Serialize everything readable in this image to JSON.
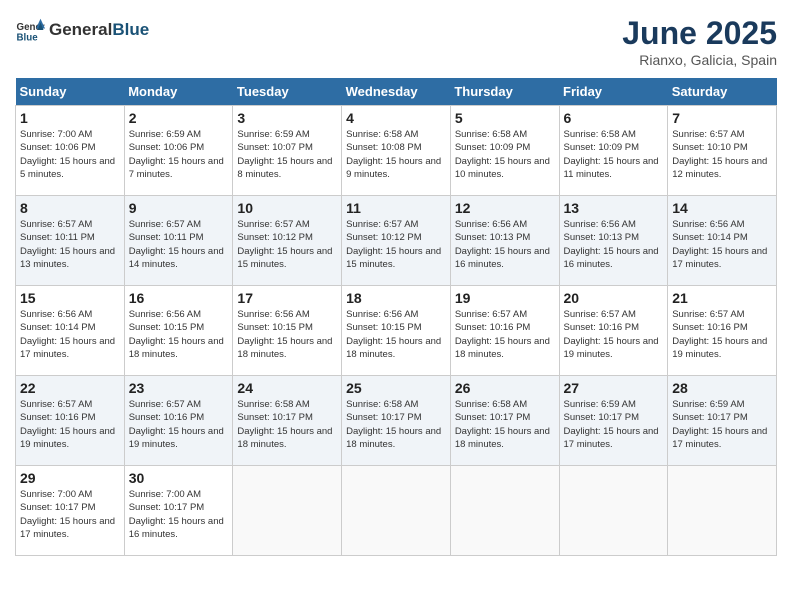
{
  "header": {
    "logo_general": "General",
    "logo_blue": "Blue",
    "month_title": "June 2025",
    "location": "Rianxo, Galicia, Spain"
  },
  "weekdays": [
    "Sunday",
    "Monday",
    "Tuesday",
    "Wednesday",
    "Thursday",
    "Friday",
    "Saturday"
  ],
  "weeks": [
    [
      {
        "day": "1",
        "sunrise": "7:00 AM",
        "sunset": "10:06 PM",
        "daylight": "15 hours and 5 minutes."
      },
      {
        "day": "2",
        "sunrise": "6:59 AM",
        "sunset": "10:06 PM",
        "daylight": "15 hours and 7 minutes."
      },
      {
        "day": "3",
        "sunrise": "6:59 AM",
        "sunset": "10:07 PM",
        "daylight": "15 hours and 8 minutes."
      },
      {
        "day": "4",
        "sunrise": "6:58 AM",
        "sunset": "10:08 PM",
        "daylight": "15 hours and 9 minutes."
      },
      {
        "day": "5",
        "sunrise": "6:58 AM",
        "sunset": "10:09 PM",
        "daylight": "15 hours and 10 minutes."
      },
      {
        "day": "6",
        "sunrise": "6:58 AM",
        "sunset": "10:09 PM",
        "daylight": "15 hours and 11 minutes."
      },
      {
        "day": "7",
        "sunrise": "6:57 AM",
        "sunset": "10:10 PM",
        "daylight": "15 hours and 12 minutes."
      }
    ],
    [
      {
        "day": "8",
        "sunrise": "6:57 AM",
        "sunset": "10:11 PM",
        "daylight": "15 hours and 13 minutes."
      },
      {
        "day": "9",
        "sunrise": "6:57 AM",
        "sunset": "10:11 PM",
        "daylight": "15 hours and 14 minutes."
      },
      {
        "day": "10",
        "sunrise": "6:57 AM",
        "sunset": "10:12 PM",
        "daylight": "15 hours and 15 minutes."
      },
      {
        "day": "11",
        "sunrise": "6:57 AM",
        "sunset": "10:12 PM",
        "daylight": "15 hours and 15 minutes."
      },
      {
        "day": "12",
        "sunrise": "6:56 AM",
        "sunset": "10:13 PM",
        "daylight": "15 hours and 16 minutes."
      },
      {
        "day": "13",
        "sunrise": "6:56 AM",
        "sunset": "10:13 PM",
        "daylight": "15 hours and 16 minutes."
      },
      {
        "day": "14",
        "sunrise": "6:56 AM",
        "sunset": "10:14 PM",
        "daylight": "15 hours and 17 minutes."
      }
    ],
    [
      {
        "day": "15",
        "sunrise": "6:56 AM",
        "sunset": "10:14 PM",
        "daylight": "15 hours and 17 minutes."
      },
      {
        "day": "16",
        "sunrise": "6:56 AM",
        "sunset": "10:15 PM",
        "daylight": "15 hours and 18 minutes."
      },
      {
        "day": "17",
        "sunrise": "6:56 AM",
        "sunset": "10:15 PM",
        "daylight": "15 hours and 18 minutes."
      },
      {
        "day": "18",
        "sunrise": "6:56 AM",
        "sunset": "10:15 PM",
        "daylight": "15 hours and 18 minutes."
      },
      {
        "day": "19",
        "sunrise": "6:57 AM",
        "sunset": "10:16 PM",
        "daylight": "15 hours and 18 minutes."
      },
      {
        "day": "20",
        "sunrise": "6:57 AM",
        "sunset": "10:16 PM",
        "daylight": "15 hours and 19 minutes."
      },
      {
        "day": "21",
        "sunrise": "6:57 AM",
        "sunset": "10:16 PM",
        "daylight": "15 hours and 19 minutes."
      }
    ],
    [
      {
        "day": "22",
        "sunrise": "6:57 AM",
        "sunset": "10:16 PM",
        "daylight": "15 hours and 19 minutes."
      },
      {
        "day": "23",
        "sunrise": "6:57 AM",
        "sunset": "10:16 PM",
        "daylight": "15 hours and 19 minutes."
      },
      {
        "day": "24",
        "sunrise": "6:58 AM",
        "sunset": "10:17 PM",
        "daylight": "15 hours and 18 minutes."
      },
      {
        "day": "25",
        "sunrise": "6:58 AM",
        "sunset": "10:17 PM",
        "daylight": "15 hours and 18 minutes."
      },
      {
        "day": "26",
        "sunrise": "6:58 AM",
        "sunset": "10:17 PM",
        "daylight": "15 hours and 18 minutes."
      },
      {
        "day": "27",
        "sunrise": "6:59 AM",
        "sunset": "10:17 PM",
        "daylight": "15 hours and 17 minutes."
      },
      {
        "day": "28",
        "sunrise": "6:59 AM",
        "sunset": "10:17 PM",
        "daylight": "15 hours and 17 minutes."
      }
    ],
    [
      {
        "day": "29",
        "sunrise": "7:00 AM",
        "sunset": "10:17 PM",
        "daylight": "15 hours and 17 minutes."
      },
      {
        "day": "30",
        "sunrise": "7:00 AM",
        "sunset": "10:17 PM",
        "daylight": "15 hours and 16 minutes."
      },
      null,
      null,
      null,
      null,
      null
    ]
  ]
}
